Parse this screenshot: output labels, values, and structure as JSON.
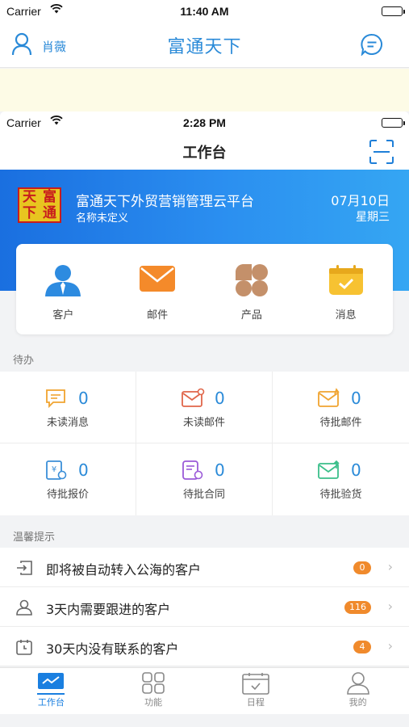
{
  "outer_status": {
    "carrier": "Carrier",
    "time": "11:40 AM"
  },
  "outer_nav": {
    "user_name": "肖薇",
    "title": "富通天下"
  },
  "inner_status": {
    "carrier": "Carrier",
    "time": "2:28 PM"
  },
  "inner_nav": {
    "title": "工作台"
  },
  "header": {
    "logo_chars": [
      "天",
      "富",
      "下",
      "通"
    ],
    "company": "富通天下外贸营销管理云平台",
    "subtitle": "名称未定义",
    "date": "07月10日",
    "weekday": "星期三"
  },
  "quick_links": [
    {
      "label": "客户",
      "icon": "customer-icon"
    },
    {
      "label": "邮件",
      "icon": "mail-icon"
    },
    {
      "label": "产品",
      "icon": "product-icon"
    },
    {
      "label": "消息",
      "icon": "message-icon"
    }
  ],
  "todo": {
    "section_title": "待办",
    "items": [
      {
        "label": "未读消息",
        "count": "0",
        "icon": "unread-message-icon"
      },
      {
        "label": "未读邮件",
        "count": "0",
        "icon": "unread-mail-icon"
      },
      {
        "label": "待批邮件",
        "count": "0",
        "icon": "pending-mail-icon"
      },
      {
        "label": "待批报价",
        "count": "0",
        "icon": "pending-quote-icon"
      },
      {
        "label": "待批合同",
        "count": "0",
        "icon": "pending-contract-icon"
      },
      {
        "label": "待批验货",
        "count": "0",
        "icon": "pending-inspection-icon"
      }
    ]
  },
  "tips": {
    "section_title": "温馨提示",
    "items": [
      {
        "label": "即将被自动转入公海的客户",
        "badge": "0",
        "icon": "transfer-icon"
      },
      {
        "label": "3天内需要跟进的客户",
        "badge": "116",
        "icon": "person-icon"
      },
      {
        "label": "30天内没有联系的客户",
        "badge": "4",
        "icon": "calendar-icon"
      }
    ]
  },
  "tabbar": [
    {
      "label": "工作台",
      "icon": "workbench-icon",
      "active": true
    },
    {
      "label": "功能",
      "icon": "grid-icon",
      "active": false
    },
    {
      "label": "日程",
      "icon": "schedule-icon",
      "active": false
    },
    {
      "label": "我的",
      "icon": "profile-icon",
      "active": false
    }
  ],
  "colors": {
    "accent": "#2a8ad8",
    "header_gradient_start": "#1a6fe0",
    "header_gradient_end": "#35a6f3",
    "badge": "#f08a2c"
  }
}
